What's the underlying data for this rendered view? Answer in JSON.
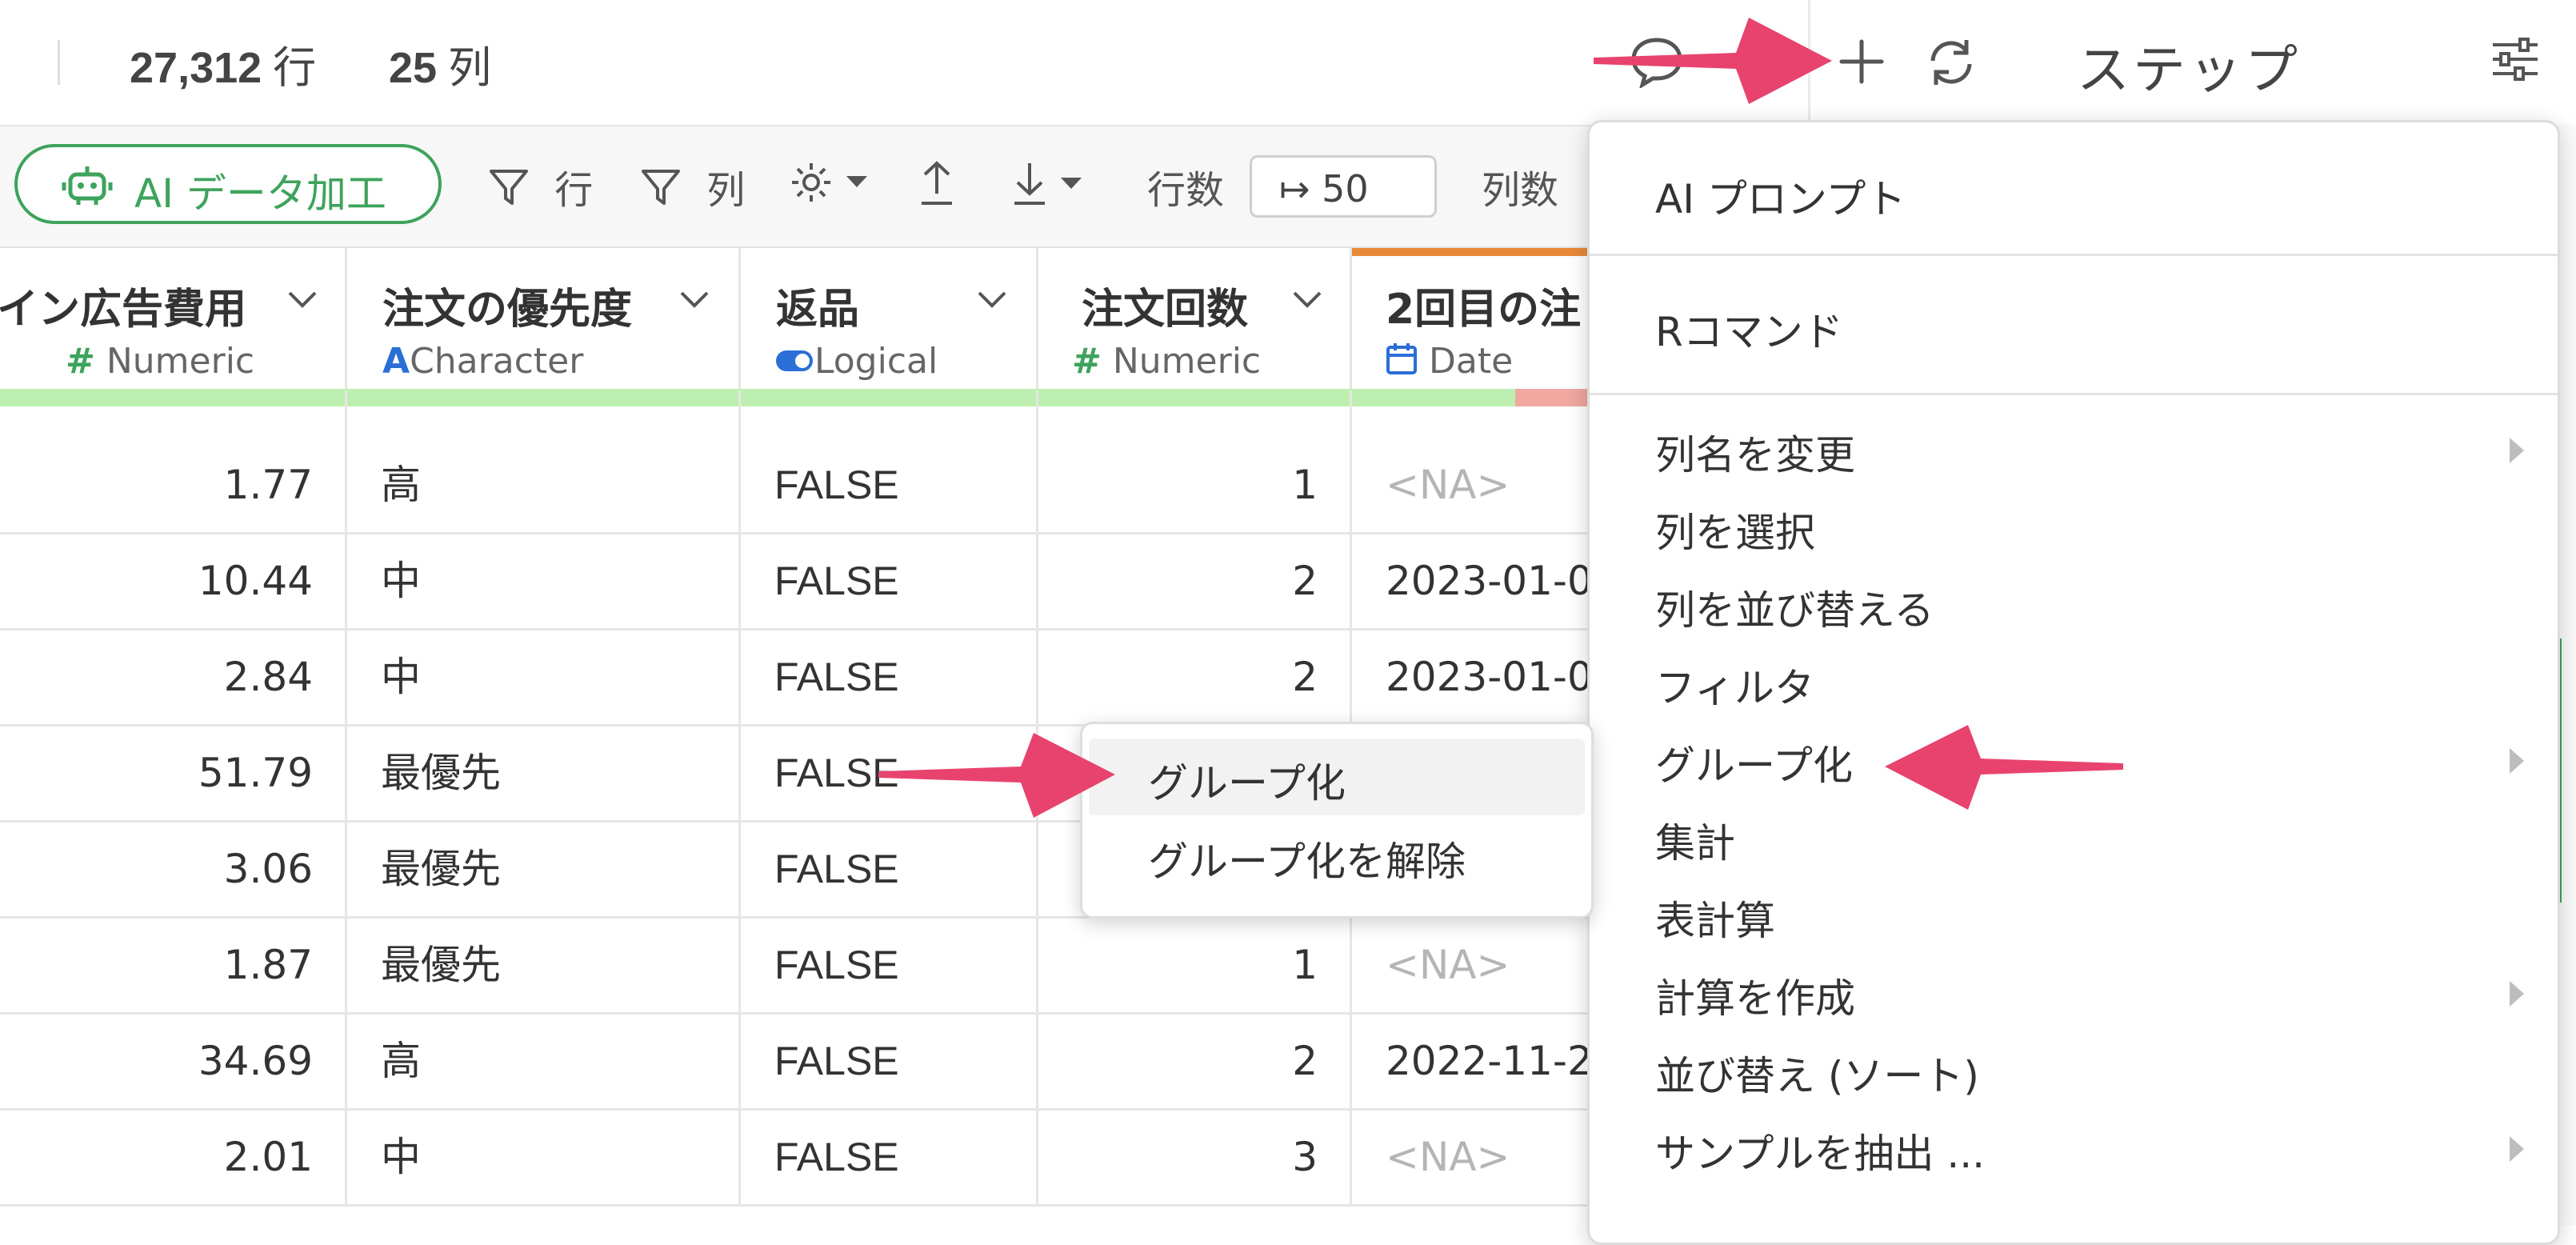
{
  "topbar": {
    "rows_count": "27,312",
    "rows_unit": "行",
    "cols_count": "25",
    "cols_unit": "列",
    "steps_title": "ステップ"
  },
  "toolbar": {
    "ai_button": "AI データ加工",
    "filter_rows": "行",
    "filter_cols": "列",
    "rows_label": "行数",
    "rows_value": "↦ 50",
    "cols_label": "列数"
  },
  "columns": [
    {
      "name": "イン広告費用",
      "type": "Numeric",
      "type_icon": "#"
    },
    {
      "name": "注文の優先度",
      "type": "Character",
      "type_icon": "A"
    },
    {
      "name": "返品",
      "type": "Logical",
      "type_icon": "toggle"
    },
    {
      "name": "注文回数",
      "type": "Numeric",
      "type_icon": "#"
    },
    {
      "name": "2回目の注",
      "type": "Date",
      "type_icon": "calendar"
    }
  ],
  "rows": [
    [
      "1.77",
      "高",
      "FALSE",
      "1",
      "<NA>"
    ],
    [
      "10.44",
      "中",
      "FALSE",
      "2",
      "2023-01-0"
    ],
    [
      "2.84",
      "中",
      "FALSE",
      "2",
      "2023-01-0"
    ],
    [
      "51.79",
      "最優先",
      "FALSE",
      "",
      ""
    ],
    [
      "3.06",
      "最優先",
      "FALSE",
      "",
      ""
    ],
    [
      "1.87",
      "最優先",
      "FALSE",
      "1",
      "<NA>"
    ],
    [
      "34.69",
      "高",
      "FALSE",
      "2",
      "2022-11-2"
    ],
    [
      "2.01",
      "中",
      "FALSE",
      "3",
      "<NA>"
    ]
  ],
  "menu": {
    "ai_prompt": "AI プロンプト",
    "r_command": "Rコマンド",
    "items": [
      {
        "label": "列名を変更",
        "submenu": true
      },
      {
        "label": "列を選択",
        "submenu": false
      },
      {
        "label": "列を並び替える",
        "submenu": false
      },
      {
        "label": "フィルタ",
        "submenu": false
      },
      {
        "label": "グループ化",
        "submenu": true
      },
      {
        "label": "集計",
        "submenu": false
      },
      {
        "label": "表計算",
        "submenu": false
      },
      {
        "label": "計算を作成",
        "submenu": true
      },
      {
        "label": "並び替え (ソート)",
        "submenu": false
      },
      {
        "label": "サンプルを抽出 ...",
        "submenu": true
      }
    ]
  },
  "context_menu": {
    "items": [
      "グループ化",
      "グループ化を解除"
    ]
  },
  "colors": {
    "accent_green": "#3ea35c",
    "annotation_arrow": "#e8436e",
    "quality_ok": "#bdf0b0",
    "quality_na": "#f0a8a0",
    "date_header_bar": "#e8893a"
  }
}
